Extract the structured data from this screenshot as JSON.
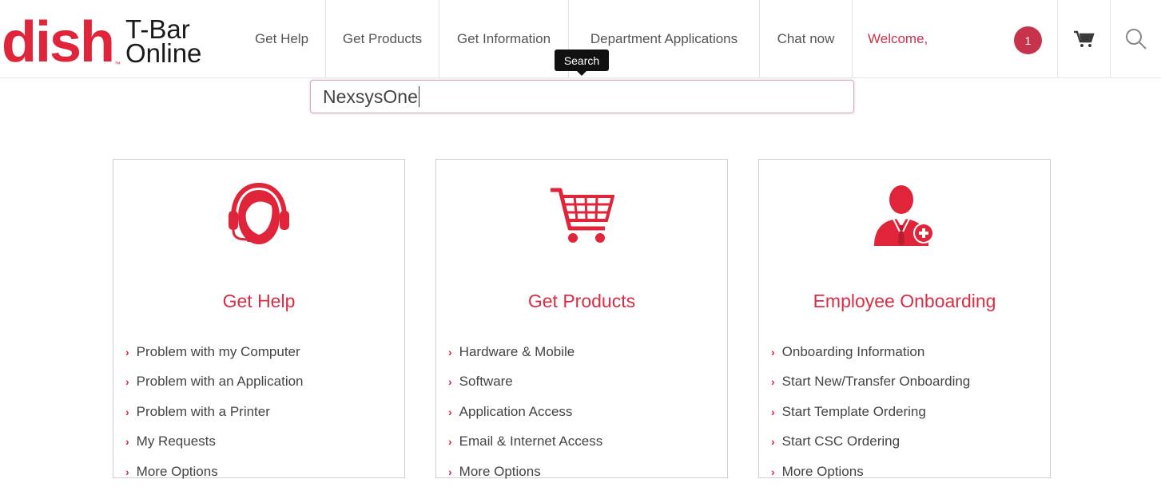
{
  "brand": {
    "wordmark": "dish",
    "tm": "™",
    "line1": "T-Bar",
    "line2": "Online",
    "color": "#e0253a"
  },
  "nav": {
    "items": [
      "Get Help",
      "Get Products",
      "Get Information",
      "Department Applications",
      "Chat now"
    ],
    "welcome": "Welcome,",
    "notification_count": "1",
    "cart_icon": "cart-icon",
    "search_icon": "search-icon"
  },
  "search": {
    "tooltip": "Search",
    "value": "NexsysOne"
  },
  "cards": [
    {
      "title": "Get Help",
      "icon": "headset-agent-icon",
      "links": [
        "Problem with my Computer",
        "Problem with an Application",
        "Problem with a Printer",
        "My Requests",
        "More Options"
      ]
    },
    {
      "title": "Get Products",
      "icon": "shopping-cart-icon",
      "links": [
        "Hardware & Mobile",
        "Software",
        "Application Access",
        "Email & Internet Access",
        "More Options"
      ]
    },
    {
      "title": "Employee Onboarding",
      "icon": "add-user-icon",
      "links": [
        "Onboarding Information",
        "Start New/Transfer Onboarding",
        "Start Template Ordering",
        "Start CSC Ordering",
        "More Options"
      ]
    }
  ],
  "accent": "#d92d44"
}
